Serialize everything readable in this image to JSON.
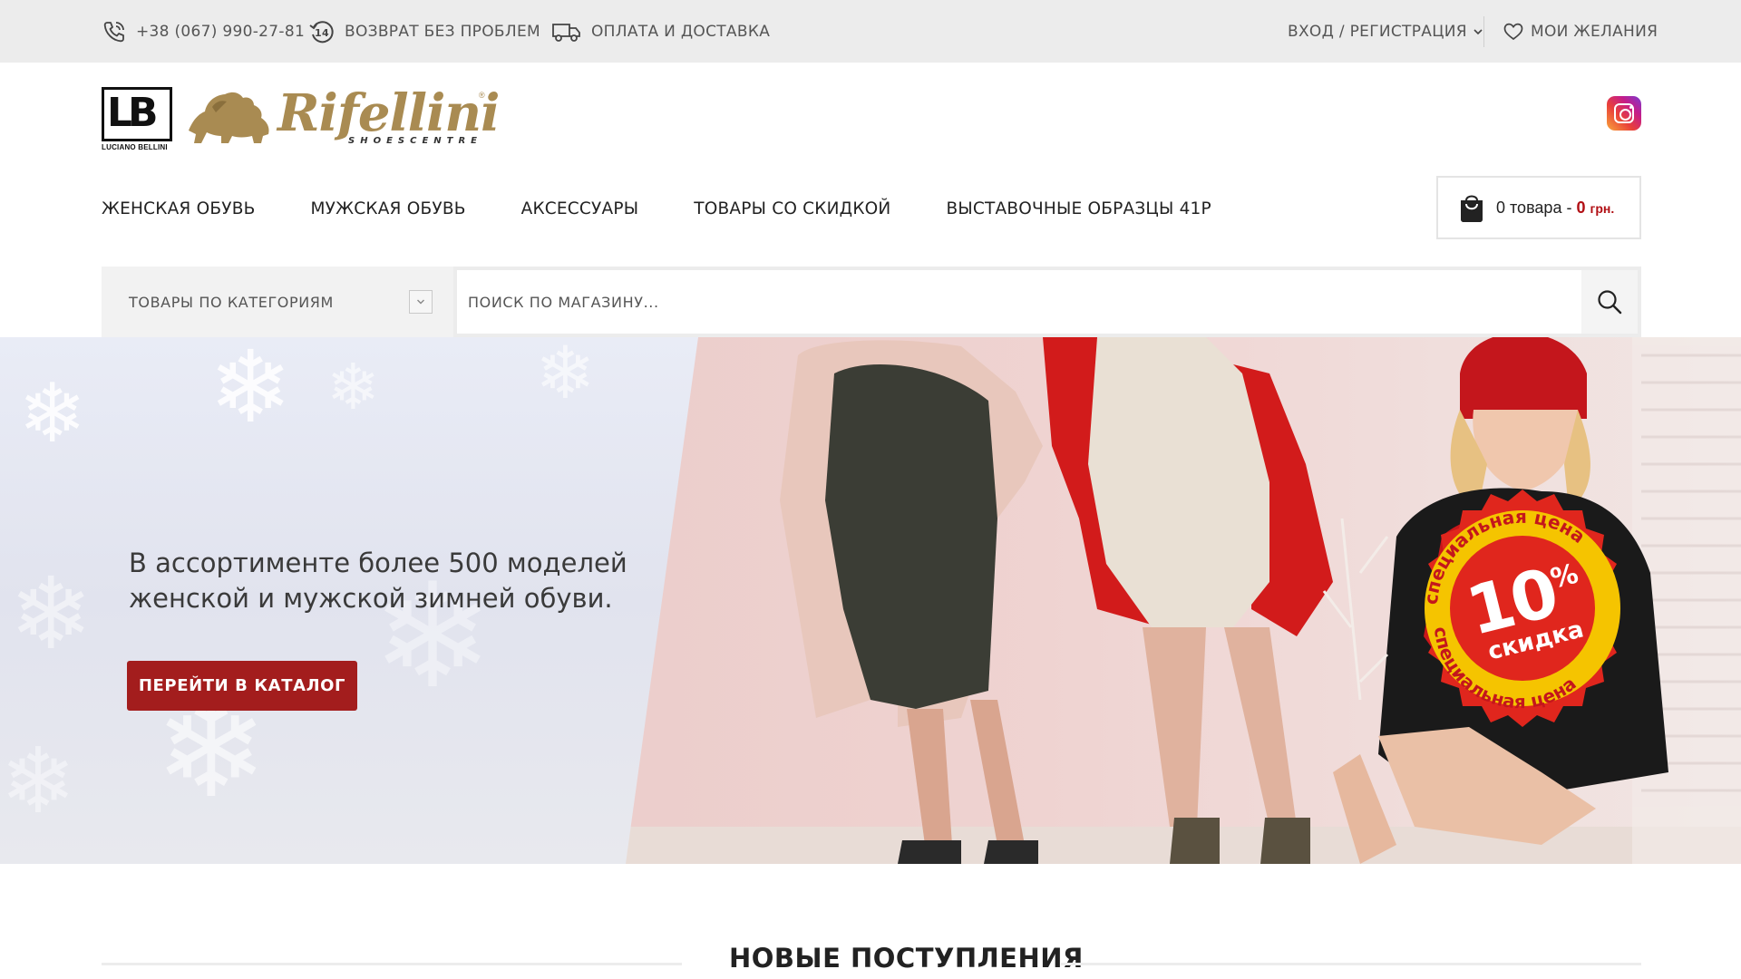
{
  "topbar": {
    "phone": "+38 (067) 990-27-81",
    "returns": "ВОЗВРАТ БЕЗ ПРОБЛЕМ",
    "returns_badge": "14",
    "payment": "ОПЛАТА И ДОСТАВКА",
    "login": "ВХОД / РЕГИСТРАЦИЯ",
    "wishlist": "МОИ ЖЕЛАНИЯ"
  },
  "logo": {
    "lb_letters": "LB",
    "lb_caption": "LUCIANO BELLINI",
    "brand_name": "Rifellini",
    "brand_sub": "SHOESCENTRE",
    "brand_reg": "®"
  },
  "nav": {
    "items": [
      {
        "label": "ЖЕНСКАЯ ОБУВЬ"
      },
      {
        "label": "МУЖСКАЯ ОБУВЬ"
      },
      {
        "label": "АКСЕССУАРЫ"
      },
      {
        "label": "ТОВАРЫ СО СКИДКОЙ"
      },
      {
        "label": "ВЫСТАВОЧНЫЕ ОБРАЗЦЫ 41Р"
      }
    ]
  },
  "cart": {
    "count_text": "0 товара",
    "sep": "-",
    "amount": "0",
    "currency": "грн."
  },
  "search": {
    "category_label": "ТОВАРЫ ПО КАТЕГОРИЯМ",
    "placeholder": "ПОИСК ПО МАГАЗИНУ..."
  },
  "hero": {
    "text_line1": "В ассортименте более 500 моделей",
    "text_line2": "женской и мужской зимней обуви.",
    "button": "ПЕРЕЙТИ В КАТАЛОГ",
    "badge_top": "специальная цена",
    "badge_bottom": "специальная цена",
    "badge_number": "10",
    "badge_percent": "%",
    "badge_word": "скидка"
  },
  "section": {
    "title": "НОВЫЕ ПОСТУПЛЕНИЯ"
  },
  "colors": {
    "accent": "#a31d1d",
    "price": "#b10f14",
    "brand_gold": "#a98b52",
    "topbar_bg": "#ececec",
    "badge_red": "#e0261d",
    "badge_yellow": "#f5c400"
  }
}
